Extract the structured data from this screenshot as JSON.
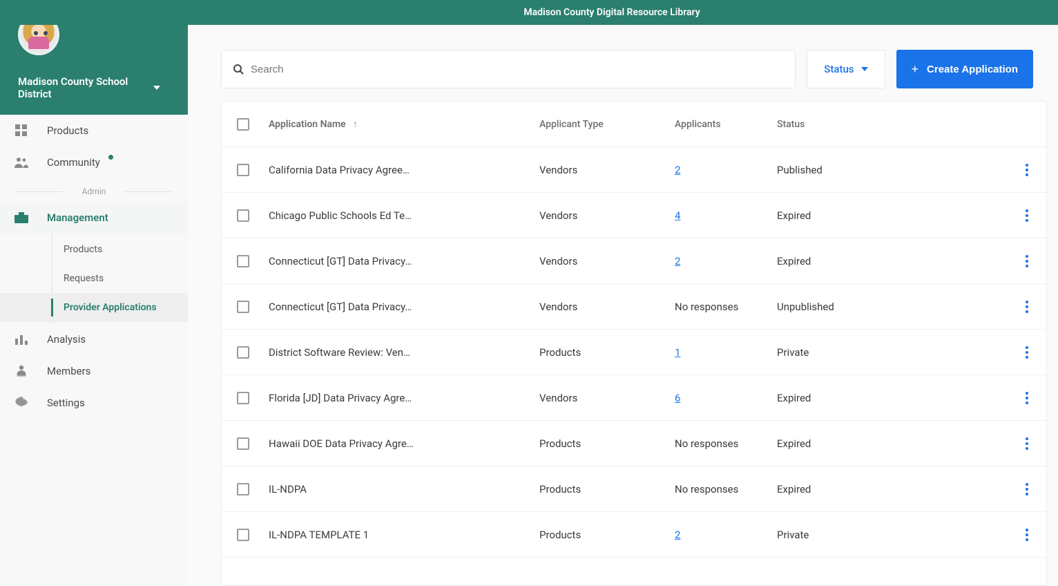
{
  "banner": {
    "title": "Madison County Digital Resource Library"
  },
  "org": {
    "name": "Madison County School District"
  },
  "sidebar": {
    "top_items": [
      {
        "label": "Products",
        "icon": "grid"
      },
      {
        "label": "Community",
        "icon": "people",
        "badge": true
      }
    ],
    "admin_label": "Admin",
    "management_label": "Management",
    "management_children": [
      {
        "label": "Products"
      },
      {
        "label": "Requests"
      },
      {
        "label": "Provider Applications",
        "active": true
      }
    ],
    "bottom_items": [
      {
        "label": "Analysis",
        "icon": "bars"
      },
      {
        "label": "Members",
        "icon": "member"
      },
      {
        "label": "Settings",
        "icon": "gear"
      }
    ]
  },
  "toolbar": {
    "search_placeholder": "Search",
    "status_label": "Status",
    "create_label": "Create Application"
  },
  "table": {
    "columns": {
      "name": "Application Name",
      "type": "Applicant Type",
      "applicants": "Applicants",
      "status": "Status"
    },
    "rows": [
      {
        "name": "California Data Privacy Agree…",
        "type": "Vendors",
        "applicants": "2",
        "applicants_link": true,
        "status": "Published"
      },
      {
        "name": "Chicago Public Schools Ed Te…",
        "type": "Vendors",
        "applicants": "4",
        "applicants_link": true,
        "status": "Expired"
      },
      {
        "name": "Connecticut [GT] Data Privacy…",
        "type": "Vendors",
        "applicants": "2",
        "applicants_link": true,
        "status": "Expired"
      },
      {
        "name": "Connecticut [GT] Data Privacy…",
        "type": "Vendors",
        "applicants": "No responses",
        "applicants_link": false,
        "status": "Unpublished"
      },
      {
        "name": "District Software Review: Ven…",
        "type": "Products",
        "applicants": "1",
        "applicants_link": true,
        "status": "Private"
      },
      {
        "name": "Florida [JD] Data Privacy Agre…",
        "type": "Vendors",
        "applicants": "6",
        "applicants_link": true,
        "status": "Expired"
      },
      {
        "name": "Hawaii DOE Data Privacy Agre…",
        "type": "Products",
        "applicants": "No responses",
        "applicants_link": false,
        "status": "Expired"
      },
      {
        "name": "IL-NDPA",
        "type": "Products",
        "applicants": "No responses",
        "applicants_link": false,
        "status": "Expired"
      },
      {
        "name": "IL-NDPA TEMPLATE 1",
        "type": "Products",
        "applicants": "2",
        "applicants_link": true,
        "status": "Private"
      }
    ]
  }
}
